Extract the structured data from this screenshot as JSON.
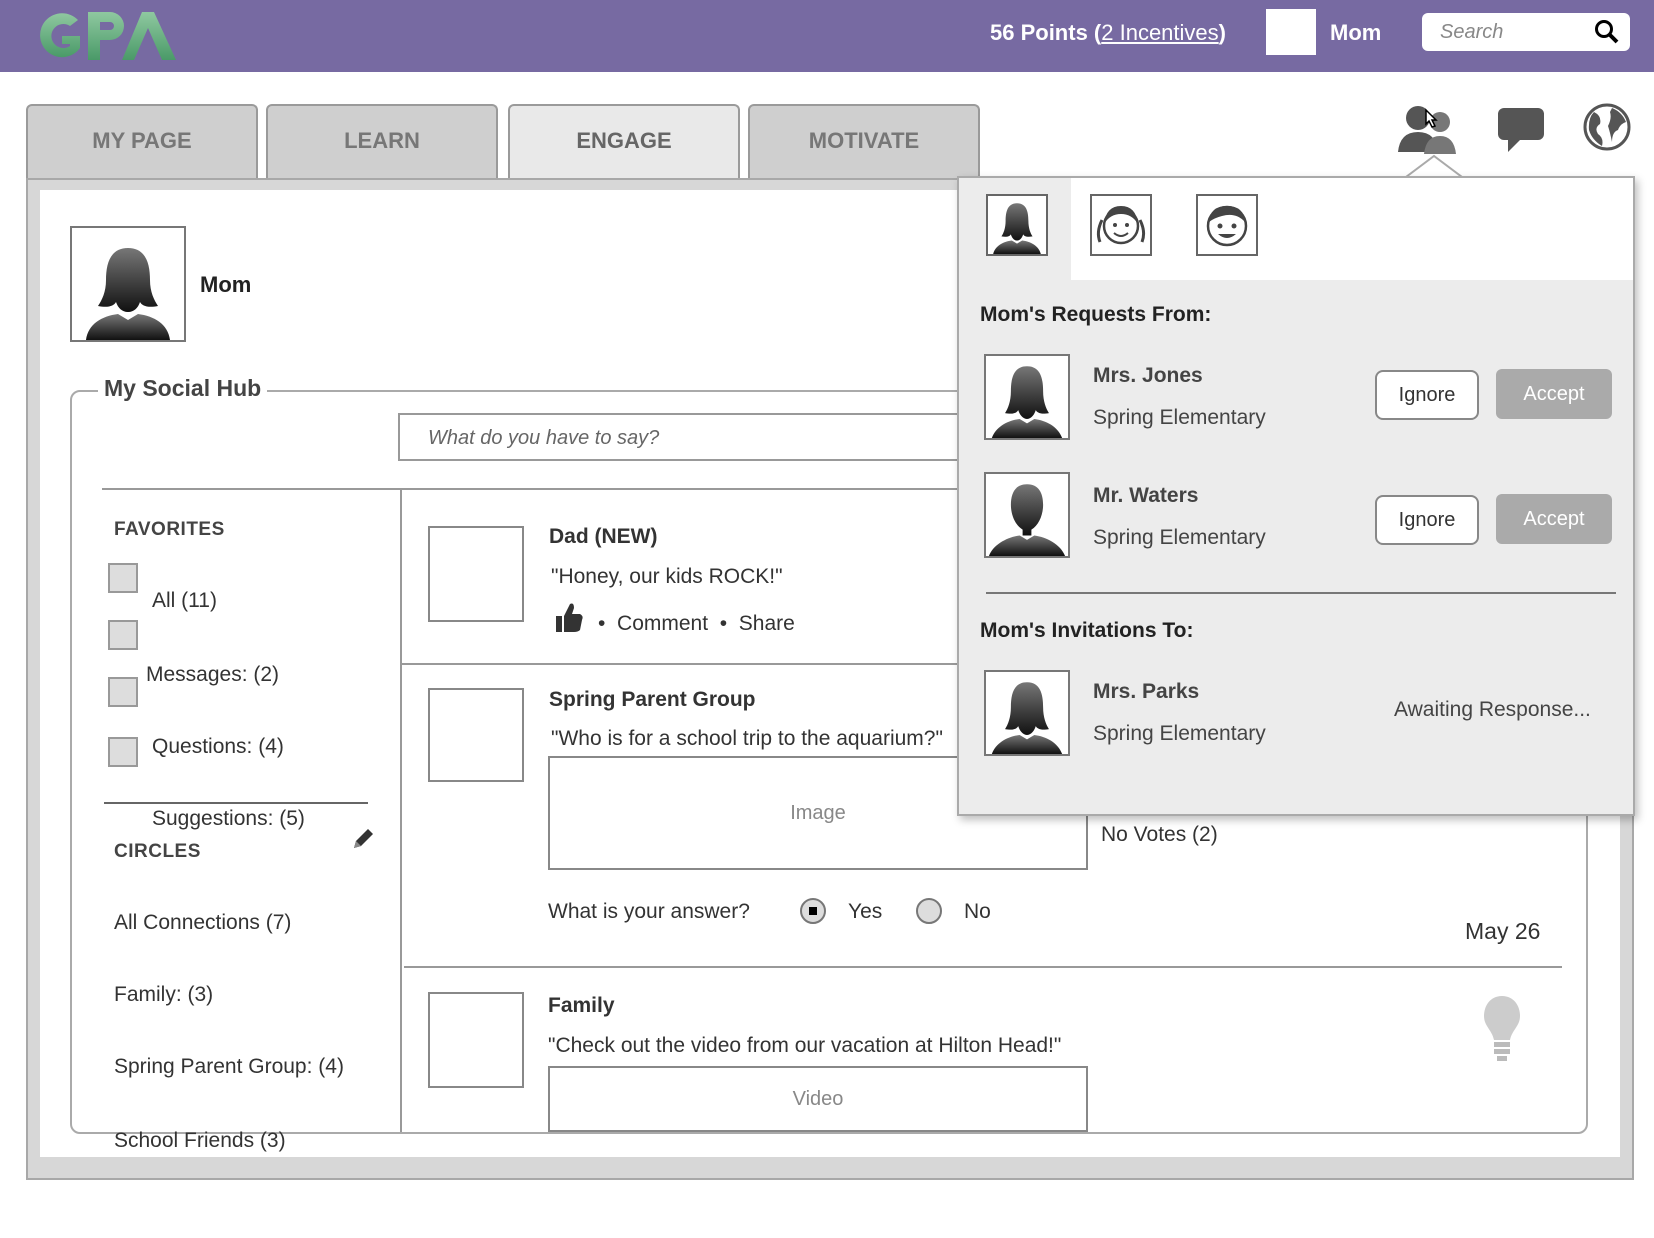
{
  "header": {
    "points_label": "56 Points (",
    "incentives_link": "2 Incentives",
    "points_close": ")",
    "user_name": "Mom",
    "search_placeholder": "Search",
    "brand_color": "#776aa2"
  },
  "tabs": [
    {
      "label": "MY PAGE"
    },
    {
      "label": "LEARN"
    },
    {
      "label": "ENGAGE"
    },
    {
      "label": "MOTIVATE"
    }
  ],
  "profile": {
    "name": "Mom"
  },
  "hub": {
    "title": "My Social Hub",
    "input_placeholder": "What do you have to say?"
  },
  "sidebar": {
    "favorites_heading": "FAVORITES",
    "favorites": [
      {
        "label": "All (11)"
      },
      {
        "label": "Messages: (2)"
      },
      {
        "label": "Questions: (4)"
      },
      {
        "label": "Suggestions: (5)"
      }
    ],
    "circles_heading": "CIRCLES",
    "circles": [
      {
        "label": "All Connections (7)"
      },
      {
        "label": "Family: (3)"
      },
      {
        "label": "Spring Parent Group: (4)"
      },
      {
        "label": "School Friends (3)"
      }
    ]
  },
  "posts": [
    {
      "title": "Dad (NEW)",
      "text": "\"Honey, our kids ROCK!\"",
      "comment": "Comment",
      "share": "Share"
    },
    {
      "title": "Spring Parent Group",
      "text": "\"Who is for a school trip to the aquarium?\"",
      "media": "Image",
      "votes": "No Votes (2)",
      "question": "What is your answer?",
      "yes": "Yes",
      "no": "No",
      "date": "May 26",
      "selected": "Yes"
    },
    {
      "title": "Family",
      "text": "\"Check out the video from our vacation at Hilton Head!\"",
      "media": "Video"
    }
  ],
  "popup": {
    "requests_heading": "Mom's Requests From:",
    "requests": [
      {
        "name": "Mrs. Jones",
        "school": "Spring Elementary",
        "ignore": "Ignore",
        "accept": "Accept"
      },
      {
        "name": "Mr. Waters",
        "school": "Spring Elementary",
        "ignore": "Ignore",
        "accept": "Accept"
      }
    ],
    "invitations_heading": "Mom's Invitations To:",
    "invitations": [
      {
        "name": "Mrs. Parks",
        "school": "Spring Elementary",
        "status": "Awaiting Response..."
      }
    ]
  }
}
